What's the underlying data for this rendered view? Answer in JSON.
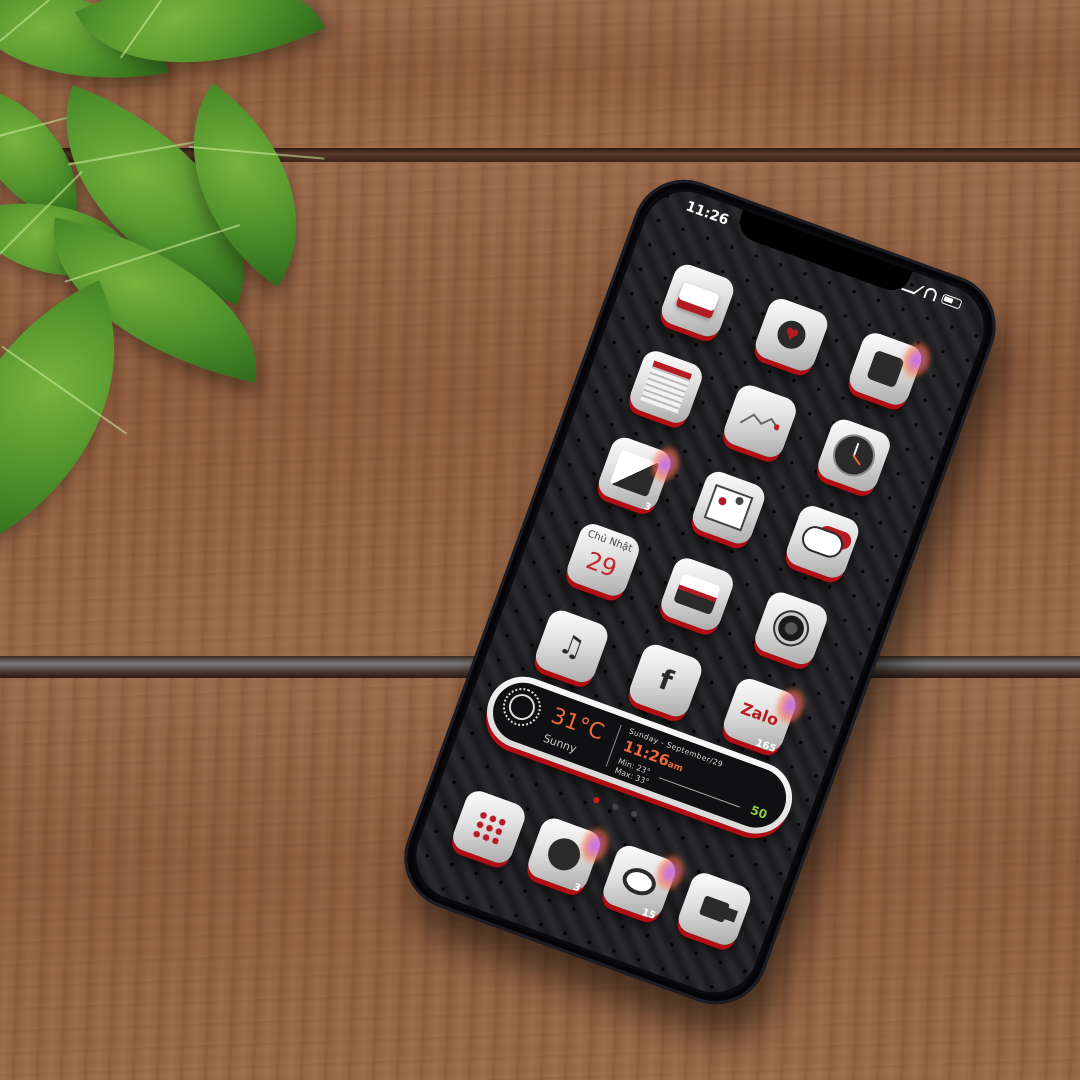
{
  "status_bar": {
    "time": "11:26"
  },
  "apps": [
    {
      "id": "wallet",
      "glyph": "wallet-icon"
    },
    {
      "id": "health",
      "glyph": "heart-icon"
    },
    {
      "id": "reminders",
      "glyph": "list-icon"
    },
    {
      "id": "notes",
      "glyph": "notes-icon"
    },
    {
      "id": "stocks",
      "glyph": "chart-icon"
    },
    {
      "id": "clock",
      "glyph": "clock-icon"
    },
    {
      "id": "photos",
      "glyph": "photos-icon",
      "badge": "3"
    },
    {
      "id": "maps",
      "glyph": "map-icon"
    },
    {
      "id": "weather",
      "glyph": "cloud-icon"
    },
    {
      "id": "calendar",
      "weekday": "Chủ Nhật",
      "day": "29"
    },
    {
      "id": "landscape",
      "glyph": "landscape-icon"
    },
    {
      "id": "camera",
      "glyph": "camera-icon"
    },
    {
      "id": "music",
      "glyph": "♫"
    },
    {
      "id": "facebook",
      "glyph": "f"
    },
    {
      "id": "zalo",
      "glyph": "Zalo",
      "badge": "165"
    }
  ],
  "weather_widget": {
    "temperature": "31°C",
    "condition": "Sunny",
    "date": "Sunday - September/29",
    "time": "11:26",
    "time_suffix": "am",
    "min": "Min: 23°",
    "max": "Max: 33°",
    "value": "50"
  },
  "dock": [
    {
      "id": "phone",
      "glyph": "dialpad-icon"
    },
    {
      "id": "messenger",
      "glyph": "messenger-icon",
      "badge": "3"
    },
    {
      "id": "messages",
      "glyph": "messages-icon",
      "badge": "15"
    },
    {
      "id": "facetime",
      "glyph": "video-icon"
    }
  ],
  "colors": {
    "accent": "#b30d14",
    "temp": "#f0683a",
    "green": "#8fcf3e"
  }
}
